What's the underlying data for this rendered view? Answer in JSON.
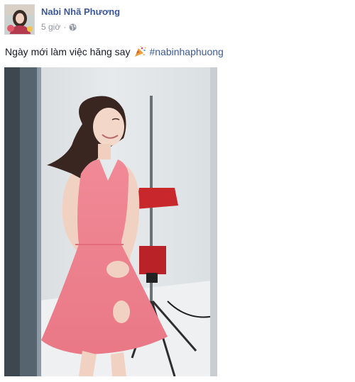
{
  "post": {
    "author": "Nabi Nhã Phương",
    "time": "5 giờ",
    "separator": "·",
    "caption_text": "Ngày mới làm việc hăng say",
    "hashtag": "#nabinhaphuong"
  },
  "icons": {
    "audience": "globe-icon",
    "caption_emoji": "party-popper-icon"
  },
  "colors": {
    "link": "#3b5998",
    "meta_text": "#9197a3",
    "dress": "#f08a96"
  }
}
